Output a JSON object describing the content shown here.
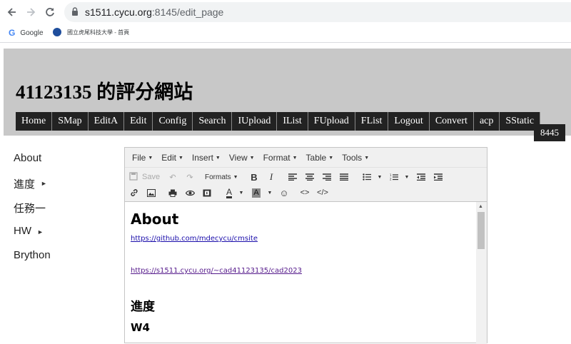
{
  "browser": {
    "url_host": "s1511.cycu.org",
    "url_path": ":8145/edit_page",
    "bookmarks": [
      {
        "label": "Google",
        "icon": "google-icon"
      },
      {
        "label": "國立虎尾科技大學 - 首頁",
        "icon": "school-icon"
      }
    ]
  },
  "site": {
    "title": "41123135 的評分網站",
    "menu": [
      "Home",
      "SMap",
      "EditA",
      "Edit",
      "Config",
      "Search",
      "IUpload",
      "IList",
      "FUpload",
      "FList",
      "Logout",
      "Convert",
      "acp",
      "SStatic"
    ],
    "port_badge": "8445"
  },
  "sidebar": {
    "items": [
      {
        "label": "About",
        "has_children": false
      },
      {
        "label": "進度",
        "has_children": true
      },
      {
        "label": "任務一",
        "has_children": false
      },
      {
        "label": "HW",
        "has_children": true
      },
      {
        "label": "Brython",
        "has_children": false
      }
    ]
  },
  "editor": {
    "menubar": [
      "File",
      "Edit",
      "Insert",
      "View",
      "Format",
      "Table",
      "Tools"
    ],
    "toolbar": {
      "save_label": "Save",
      "formats_label": "Formats"
    },
    "content": {
      "h1": "About",
      "link1": "https://github.com/mdecycu/cmsite",
      "link2": "https://s1511.cycu.org/~cad41123135/cad2023",
      "h2": "進度",
      "h3": "W4"
    }
  }
}
